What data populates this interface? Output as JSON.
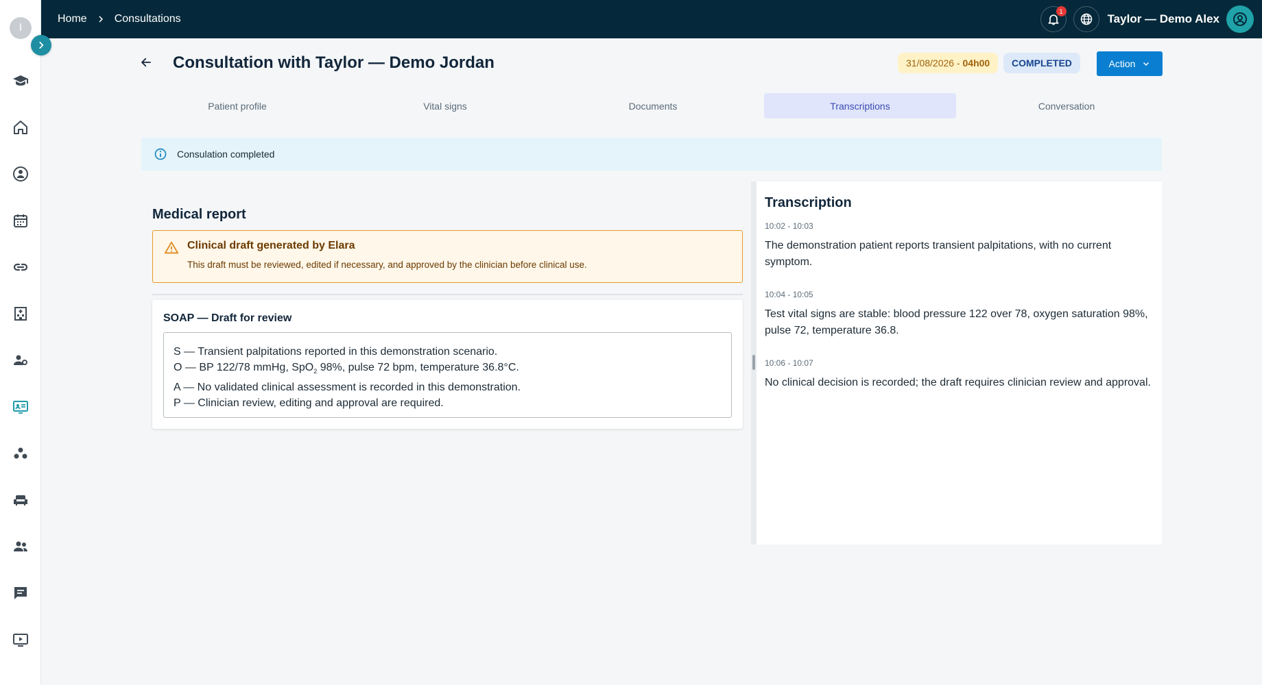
{
  "sidebar": {
    "logo_letter": "I",
    "items": [
      {
        "icon": "graduation-cap-icon"
      },
      {
        "icon": "home-icon"
      },
      {
        "icon": "doctor-icon"
      },
      {
        "icon": "calendar-icon"
      },
      {
        "icon": "link-icon"
      },
      {
        "icon": "hospital-icon"
      },
      {
        "icon": "users-settings-icon"
      },
      {
        "icon": "teleconsultation-icon",
        "active": true
      },
      {
        "icon": "network-icon"
      },
      {
        "icon": "waiting-room-icon"
      },
      {
        "icon": "group-icon"
      },
      {
        "icon": "chat-icon"
      },
      {
        "icon": "video-icon"
      }
    ]
  },
  "topbar": {
    "breadcrumb": [
      "Home",
      "Consultations"
    ],
    "notification_count": "1",
    "user_name": "Taylor — Demo Alex"
  },
  "header": {
    "title": "Consultation with Taylor — Demo Jordan",
    "date": "31/08/2026 - ",
    "time": "04h00",
    "status": "COMPLETED",
    "action_label": "Action"
  },
  "tabs": [
    {
      "label": "Patient profile"
    },
    {
      "label": "Vital signs"
    },
    {
      "label": "Documents"
    },
    {
      "label": "Transcriptions",
      "active": true
    },
    {
      "label": "Conversation"
    }
  ],
  "banner": {
    "text": "Consulation completed"
  },
  "report": {
    "title": "Medical report",
    "warning_title": "Clinical draft generated by Elara",
    "warning_text": "This draft must be reviewed, edited if necessary, and approved by the clinician before clinical use.",
    "soap_title": "SOAP — Draft for review",
    "soap_s": "S — Transient palpitations reported in this demonstration scenario.",
    "soap_o_pre": "O — BP 122/78 mmHg, SpO",
    "soap_o_sub": "2",
    "soap_o_post": " 98%, pulse 72 bpm, temperature 36.8°C.",
    "soap_a": "A — No validated clinical assessment is recorded in this demonstration.",
    "soap_p": "P — Clinician review, editing and approval are required."
  },
  "transcription": {
    "title": "Transcription",
    "segments": [
      {
        "time": "10:02 - 10:03",
        "text": "The demonstration patient reports transient palpitations, with no current symptom."
      },
      {
        "time": "10:04 - 10:05",
        "text": "Test vital signs are stable: blood pressure 122 over 78, oxygen saturation 98%, pulse 72, temperature 36.8."
      },
      {
        "time": "10:06 - 10:07",
        "text": "No clinical decision is recorded; the draft requires clinician review and approval."
      }
    ]
  },
  "colors": {
    "topbar": "#05293a",
    "accent": "#0a7fd1",
    "teal": "#1e8fa3",
    "warning": "#e59a28"
  }
}
